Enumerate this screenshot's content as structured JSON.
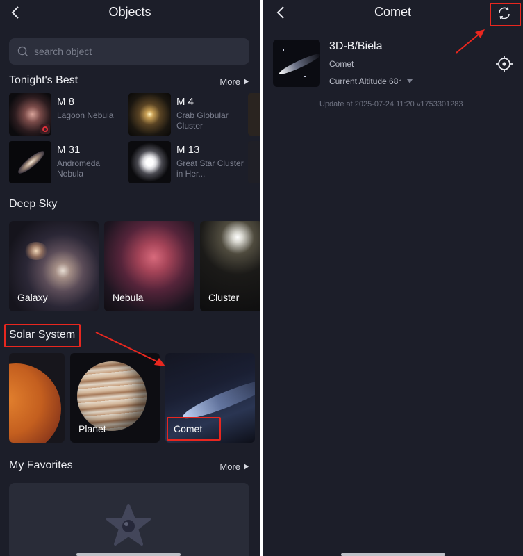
{
  "left": {
    "nav": {
      "title": "Objects"
    },
    "search": {
      "placeholder": "search object"
    },
    "tonights_best": {
      "title": "Tonight's Best",
      "more": "More",
      "items": [
        {
          "name": "M 8",
          "desc": "Lagoon Nebula"
        },
        {
          "name": "M 4",
          "desc": "Crab Globular Cluster"
        },
        {
          "name": "M 31",
          "desc": "Andromeda Nebula"
        },
        {
          "name": "M 13",
          "desc": "Great Star Cluster in Her..."
        }
      ]
    },
    "deep_sky": {
      "title": "Deep Sky",
      "cards": [
        {
          "label": "Galaxy"
        },
        {
          "label": "Nebula"
        },
        {
          "label": "Cluster"
        }
      ]
    },
    "solar_system": {
      "title": "Solar System",
      "cards": [
        {
          "label": ""
        },
        {
          "label": "Planet"
        },
        {
          "label": "Comet"
        }
      ]
    },
    "favorites": {
      "title": "My Favorites",
      "more": "More"
    }
  },
  "right": {
    "nav": {
      "title": "Comet"
    },
    "object": {
      "name": "3D-B/Biela",
      "type": "Comet",
      "altitude": "Current Altitude 68°",
      "update": "Update at 2025-07-24 11:20  v1753301283"
    }
  },
  "colors": {
    "background": "#1c1e29",
    "card": "#2c2f3c",
    "text_secondary": "#7d8190",
    "highlight": "#e8271f"
  },
  "icons": [
    "back-icon",
    "search-icon",
    "play-right-icon",
    "refresh-icon",
    "locate-crosshair-icon",
    "dropdown-icon",
    "star-icon"
  ]
}
